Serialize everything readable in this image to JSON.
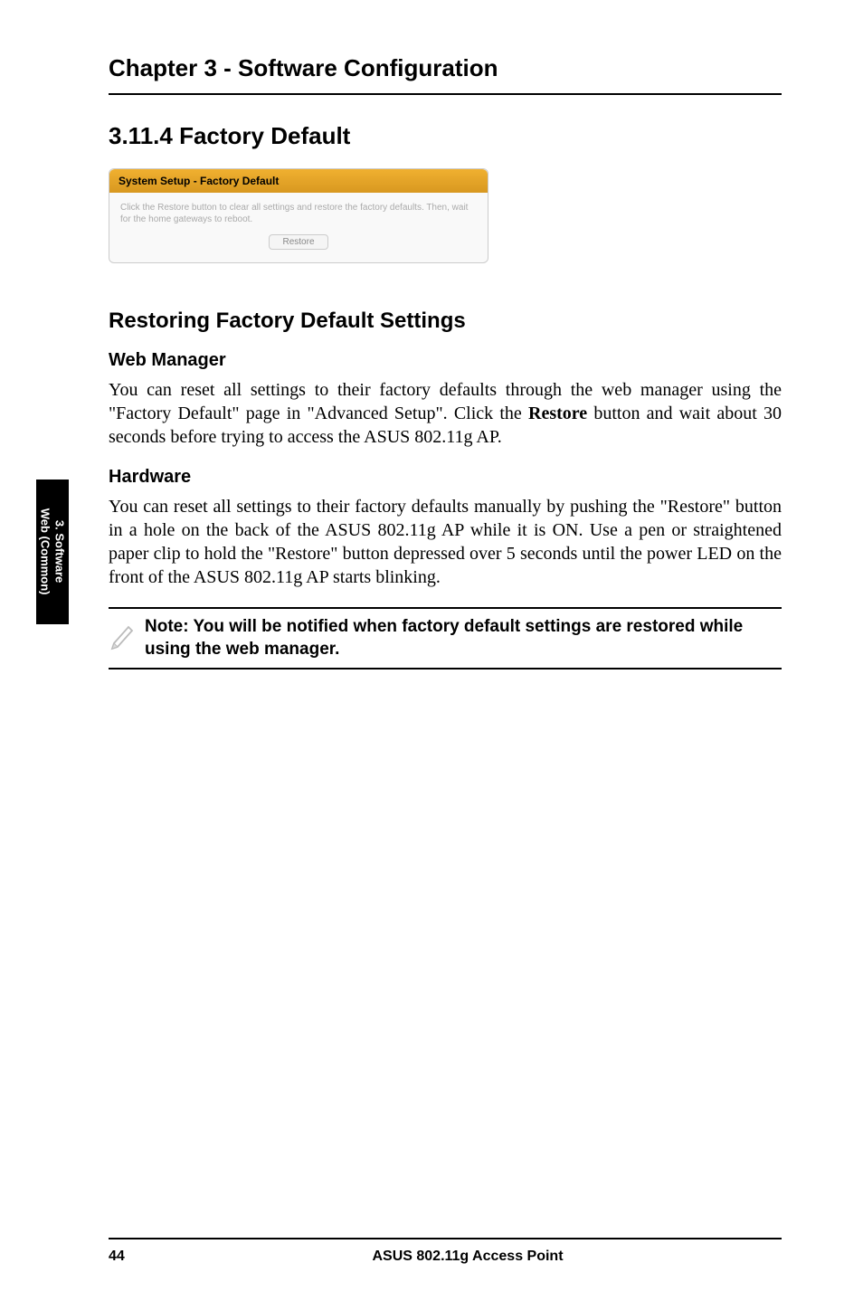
{
  "chapter_heading": "Chapter 3 - Software Configuration",
  "section_heading": "3.11.4 Factory Default",
  "screenshot": {
    "header": "System Setup - Factory Default",
    "body_text": "Click the Restore button to clear all settings and restore the factory defaults. Then, wait for the home gateways to reboot.",
    "button_label": "Restore"
  },
  "subsection_heading": "Restoring Factory Default Settings",
  "web_manager": {
    "heading": "Web Manager",
    "text_before_bold": "You can reset all settings to their factory defaults through the web manager using the \"Factory Default\" page in \"Advanced Setup\". Click the ",
    "bold_word": "Restore",
    "text_after_bold": " button and wait about 30 seconds before trying to access the ASUS 802.11g AP."
  },
  "hardware": {
    "heading": "Hardware",
    "text": "You can reset all settings to their factory defaults manually by pushing the \"Restore\" button in a hole on the back of the ASUS 802.11g AP while it is ON. Use a pen or straightened paper clip to hold the \"Restore\" button depressed over 5 seconds until the power LED on the front of the ASUS 802.11g AP starts blinking."
  },
  "note_text": "Note: You will be notified when factory default settings are restored while using the web manager.",
  "side_tab_line1": "3. Software",
  "side_tab_line2": "Web (Common)",
  "footer": {
    "page_number": "44",
    "title": "ASUS 802.11g Access Point"
  }
}
